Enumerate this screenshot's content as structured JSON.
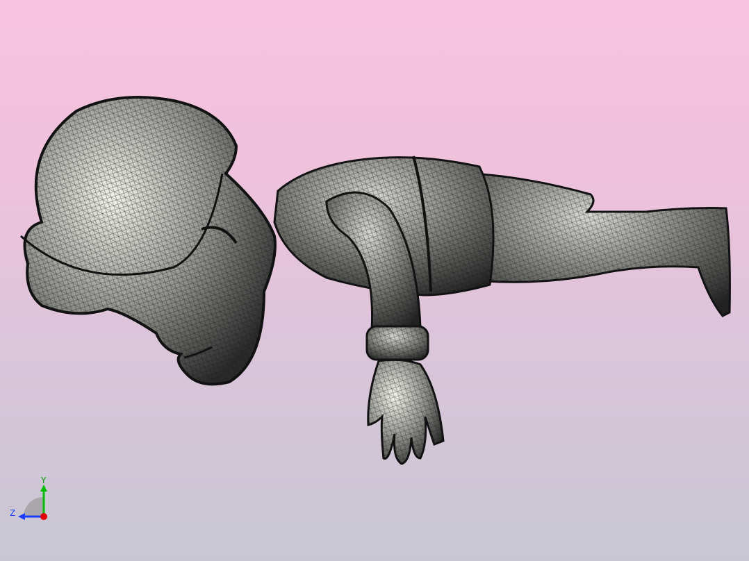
{
  "viewport": {
    "background_top": "#f8c3df",
    "background_bottom": "#c7c7d3",
    "model": "character-mesh-wireframe",
    "render_style": "shaded-with-mesh-edges"
  },
  "triad": {
    "y_label": "Y",
    "z_label": "Z",
    "y_color": "#00c000",
    "z_color": "#1a3cff",
    "x_color": "#e00000"
  }
}
